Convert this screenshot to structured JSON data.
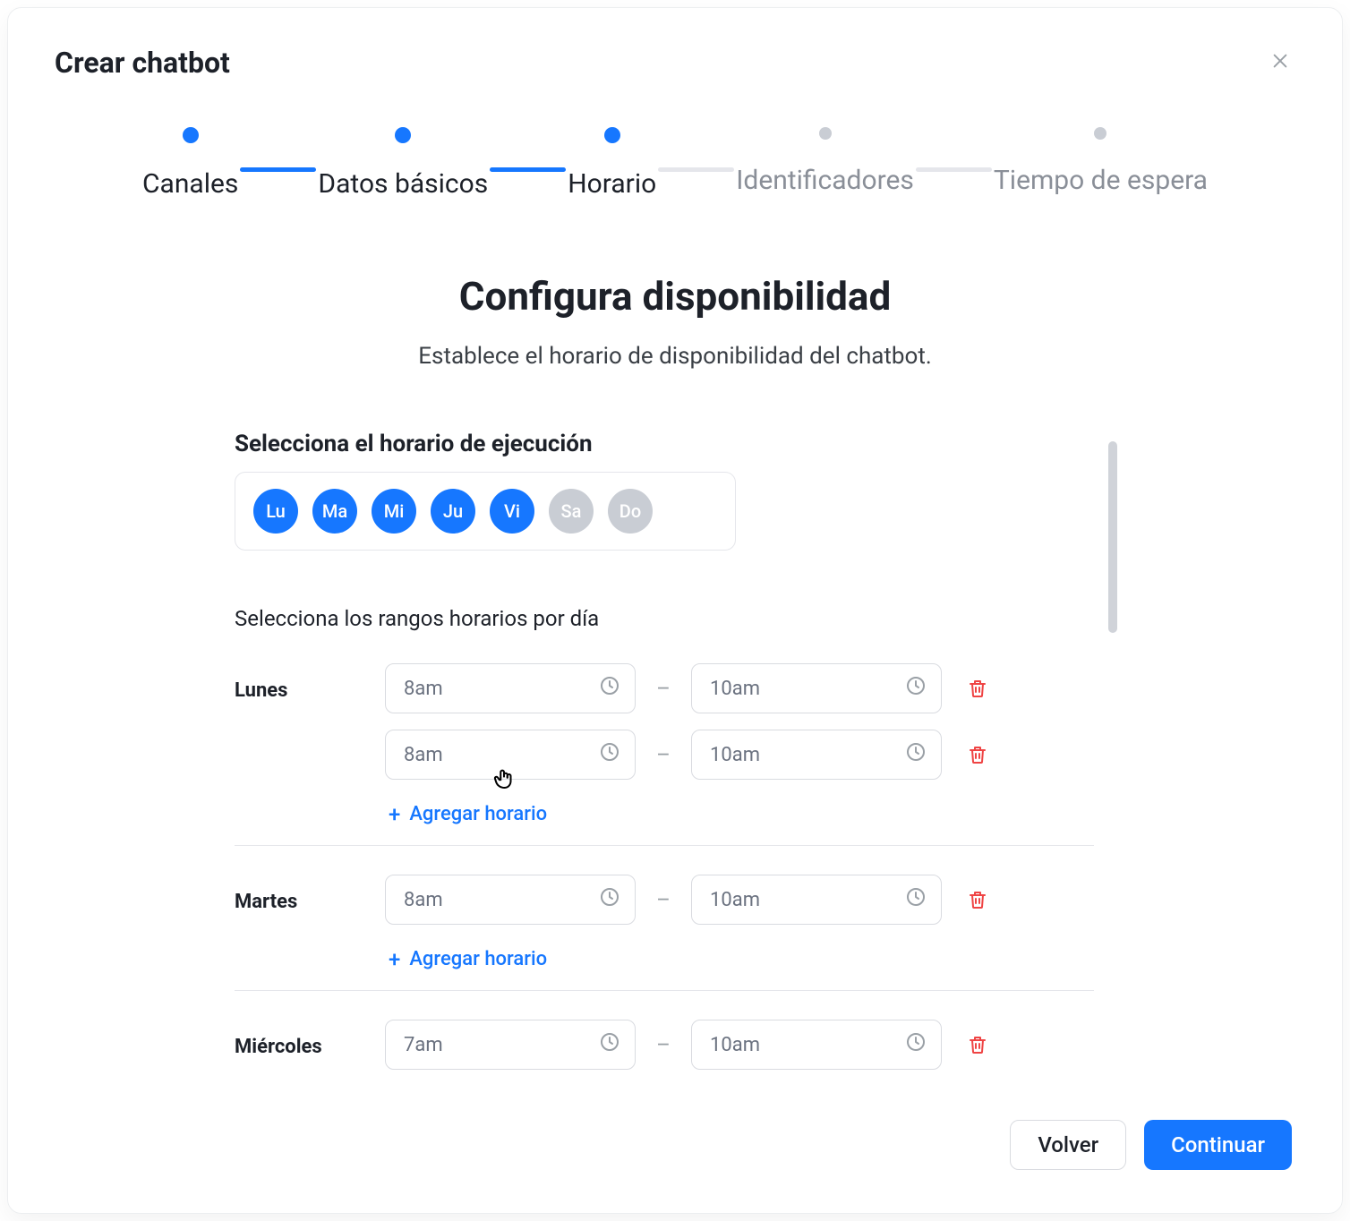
{
  "modal": {
    "title": "Crear chatbot"
  },
  "stepper": {
    "steps": [
      {
        "label": "Canales",
        "state": "done"
      },
      {
        "label": "Datos básicos",
        "state": "done"
      },
      {
        "label": "Horario",
        "state": "current"
      },
      {
        "label": "Identificadores",
        "state": "todo"
      },
      {
        "label": "Tiempo de espera",
        "state": "todo"
      }
    ]
  },
  "heading": {
    "title": "Configura disponibilidad",
    "subtitle": "Establece el horario de disponibilidad del chatbot."
  },
  "daypicker": {
    "label": "Selecciona el horario de ejecución",
    "days": [
      {
        "abbr": "Lu",
        "selected": true
      },
      {
        "abbr": "Ma",
        "selected": true
      },
      {
        "abbr": "Mi",
        "selected": true
      },
      {
        "abbr": "Ju",
        "selected": true
      },
      {
        "abbr": "Vi",
        "selected": true
      },
      {
        "abbr": "Sa",
        "selected": false
      },
      {
        "abbr": "Do",
        "selected": false
      }
    ]
  },
  "ranges": {
    "label": "Selecciona los rangos horarios por día",
    "add_label": "Agregar horario",
    "separator": "–",
    "days": [
      {
        "name": "Lunes",
        "slots": [
          {
            "from": "8am",
            "to": "10am"
          },
          {
            "from": "8am",
            "to": "10am"
          }
        ]
      },
      {
        "name": "Martes",
        "slots": [
          {
            "from": "8am",
            "to": "10am"
          }
        ]
      },
      {
        "name": "Miércoles",
        "slots": [
          {
            "from": "7am",
            "to": "10am"
          }
        ]
      }
    ]
  },
  "footer": {
    "back": "Volver",
    "next": "Continuar"
  }
}
